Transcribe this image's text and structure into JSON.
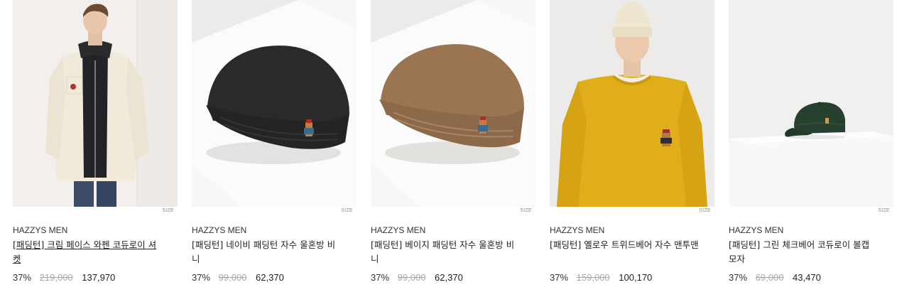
{
  "products": [
    {
      "size_label": "SIZE",
      "brand": "HAZZYS MEN",
      "name": "[패딩턴] 크림 페이스 와펜 코듀로이 셔켓",
      "discount": "37%",
      "original_price": "219,000",
      "sale_price": "137,970",
      "image_icon": "model-cream-shirt-jacket-image"
    },
    {
      "size_label": "SIZE",
      "brand": "HAZZYS MEN",
      "name": "[패딩턴] 네이비 패딩턴 자수 울혼방 비니",
      "discount": "37%",
      "original_price": "99,000",
      "sale_price": "62,370",
      "image_icon": "navy-beanie-image"
    },
    {
      "size_label": "SIZE",
      "brand": "HAZZYS MEN",
      "name": "[패딩턴] 베이지 패딩턴 자수 울혼방 비니",
      "discount": "37%",
      "original_price": "99,000",
      "sale_price": "62,370",
      "image_icon": "beige-beanie-image"
    },
    {
      "size_label": "SIZE",
      "brand": "HAZZYS MEN",
      "name": "[패딩턴] 옐로우 트위드베어 자수 맨투맨",
      "discount": "37%",
      "original_price": "159,000",
      "sale_price": "100,170",
      "image_icon": "model-yellow-sweatshirt-image"
    },
    {
      "size_label": "SIZE",
      "brand": "HAZZYS MEN",
      "name": "[패딩턴] 그린 체크베어 코듀로이 볼캡 모자",
      "discount": "37%",
      "original_price": "69,000",
      "sale_price": "43,470",
      "image_icon": "green-corduroy-cap-image"
    }
  ],
  "colors": {
    "text": "#222222",
    "strike": "#a8a8a8",
    "size_tag": "#8a8a8a"
  }
}
